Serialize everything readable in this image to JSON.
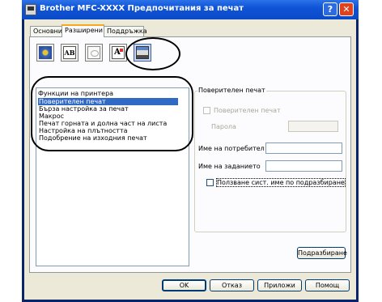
{
  "window": {
    "title": "Brother MFC-XXXX Предпочитания за печат",
    "help_label": "?",
    "close_label": "✕"
  },
  "tabs": [
    {
      "label": "Основни",
      "active": false
    },
    {
      "label": "Разширени",
      "active": true
    },
    {
      "label": "Поддръжка",
      "active": false
    }
  ],
  "toolbar": {
    "icons": [
      "watermark-icon",
      "page-setting-icon",
      "stamp-icon",
      "font-settings-icon",
      "device-options-icon"
    ],
    "ab_text": "AB",
    "aa_text": "A"
  },
  "functions": {
    "caption": "Функции на принтера",
    "items": [
      "Поверителен печат",
      "Бърза настройка за печат",
      "Макрос",
      "Печат горната и долна част на листа",
      "Настройка на плътността",
      "Подобрение на изходния печат"
    ],
    "selected_index": 0
  },
  "secure_print": {
    "title": "Поверителен печат",
    "checkbox_label": "Поверителен печат",
    "checkbox_checked": false,
    "checkbox_enabled": false,
    "password_label": "Парола",
    "password_value": "",
    "user_name_label": "Име на потребител",
    "user_name_value": "",
    "job_name_label": "Име на заданието",
    "job_name_value": "",
    "use_default_label": "Ползване сист. име по подразбиране",
    "use_default_checked": false
  },
  "buttons": {
    "default_label": "Подразбиране",
    "ok_label": "OK",
    "cancel_label": "Отказ",
    "apply_label": "Приложи",
    "help_label": "Помощ"
  }
}
